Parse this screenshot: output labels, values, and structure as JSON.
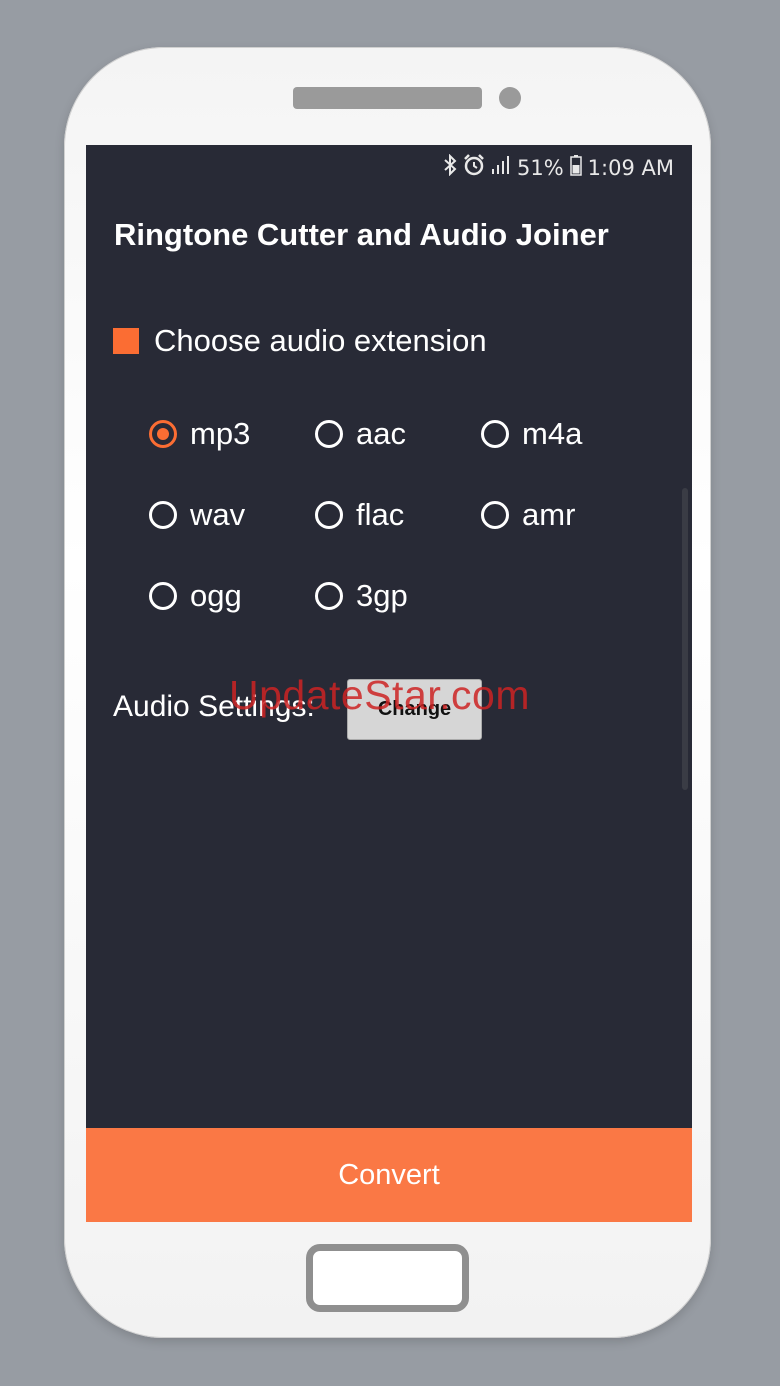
{
  "status": {
    "battery": "51%",
    "time": "1:09 AM",
    "icons": [
      "bluetooth-icon",
      "alarm-icon",
      "signal-icon",
      "battery-icon"
    ]
  },
  "app": {
    "title": "Ringtone Cutter and Audio Joiner"
  },
  "extension": {
    "label": "Choose audio extension",
    "options": [
      {
        "label": "mp3",
        "selected": true
      },
      {
        "label": "aac",
        "selected": false
      },
      {
        "label": "m4a",
        "selected": false
      },
      {
        "label": "wav",
        "selected": false
      },
      {
        "label": "flac",
        "selected": false
      },
      {
        "label": "amr",
        "selected": false
      },
      {
        "label": "ogg",
        "selected": false
      },
      {
        "label": "3gp",
        "selected": false
      }
    ]
  },
  "settings": {
    "label": "Audio Settings:",
    "change_label": "Change"
  },
  "convert_label": "Convert",
  "watermark": "UpdateStar.com",
  "colors": {
    "accent": "#fb6d33",
    "screen_bg": "#282a36",
    "convert_bg": "#fa7845"
  }
}
